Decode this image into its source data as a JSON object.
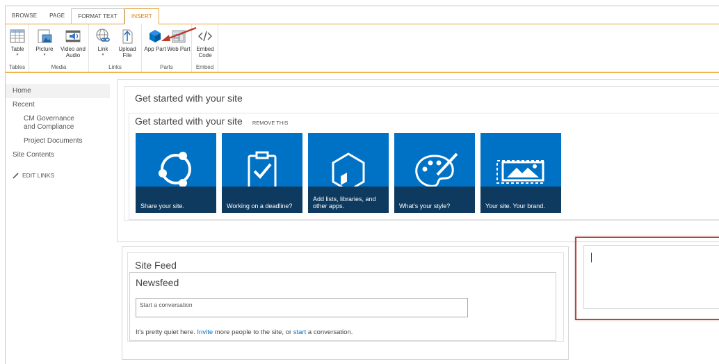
{
  "ribbon": {
    "tabs": [
      "BROWSE",
      "PAGE",
      "FORMAT TEXT",
      "INSERT"
    ],
    "groups": {
      "tables": {
        "label": "Tables",
        "commands": [
          {
            "label": "Table",
            "icon": "table-icon"
          }
        ]
      },
      "media": {
        "label": "Media",
        "commands": [
          {
            "label": "Picture",
            "icon": "picture-icon"
          },
          {
            "label": "Video and Audio",
            "icon": "video-audio-icon"
          }
        ]
      },
      "links": {
        "label": "Links",
        "commands": [
          {
            "label": "Link",
            "icon": "link-icon"
          },
          {
            "label": "Upload File",
            "icon": "upload-file-icon"
          }
        ]
      },
      "parts": {
        "label": "Parts",
        "commands": [
          {
            "label": "App Part",
            "icon": "app-part-icon"
          },
          {
            "label": "Web Part",
            "icon": "web-part-icon"
          }
        ]
      },
      "embed": {
        "label": "Embed",
        "commands": [
          {
            "label": "Embed Code",
            "icon": "embed-code-icon"
          }
        ]
      }
    }
  },
  "leftnav": {
    "items": [
      "Home",
      "Recent",
      "CM Governance and Compliance",
      "Project Documents",
      "Site Contents"
    ],
    "edit_links": "EDIT LINKS"
  },
  "get_started": {
    "title": "Get started with your site",
    "inner_title": "Get started with your site",
    "remove": "REMOVE THIS",
    "tiles": [
      {
        "caption": "Share your site.",
        "icon": "share-icon"
      },
      {
        "caption": "Working on a deadline?",
        "icon": "clipboard-check-icon"
      },
      {
        "caption": "Add lists, libraries, and other apps.",
        "icon": "apps-icon"
      },
      {
        "caption": "What's your style?",
        "icon": "palette-icon"
      },
      {
        "caption": "Your site. Your brand.",
        "icon": "brand-image-icon"
      }
    ]
  },
  "site_feed": {
    "title": "Site Feed",
    "newsfeed_title": "Newsfeed",
    "placeholder": "Start a conversation",
    "quiet_prefix": "It's pretty quiet here. ",
    "invite": "Invite",
    "quiet_middle": " more people to the site, or ",
    "start": "start",
    "quiet_suffix": " a conversation."
  },
  "colors": {
    "accent_orange": "#e07b00",
    "tile_blue": "#0072c6",
    "tile_band": "#0d3a5e",
    "highlight_red": "#b2473e",
    "arrow_red": "#c0392b"
  }
}
